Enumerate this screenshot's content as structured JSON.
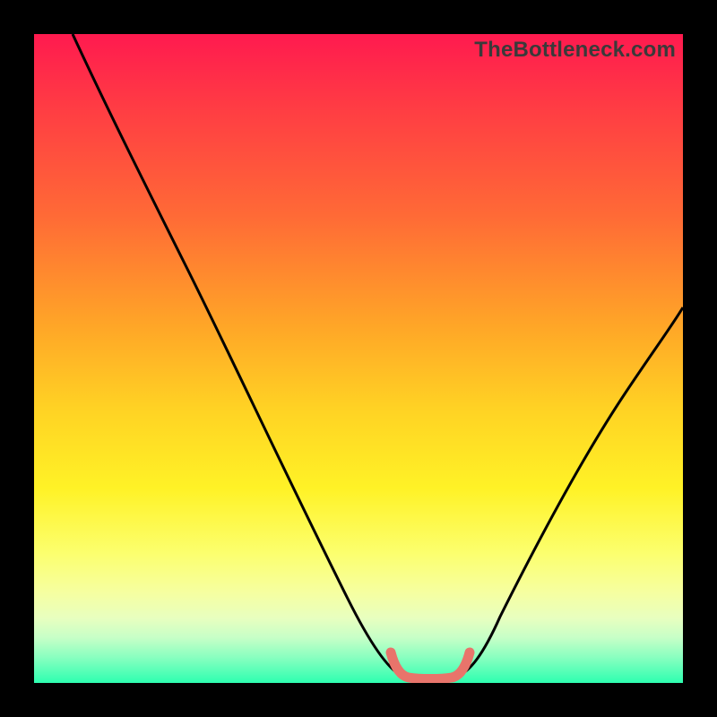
{
  "watermark": {
    "text": "TheBottleneck.com"
  },
  "chart_data": {
    "type": "line",
    "title": "",
    "xlabel": "",
    "ylabel": "",
    "xlim": [
      0,
      100
    ],
    "ylim": [
      0,
      100
    ],
    "series": [
      {
        "name": "curve-left",
        "x": [
          6,
          12,
          20,
          28,
          36,
          44,
          52,
          55,
          56.5
        ],
        "values": [
          100,
          90,
          77,
          63,
          48,
          32,
          14,
          5,
          2
        ]
      },
      {
        "name": "curve-right",
        "x": [
          65.5,
          67,
          70,
          76,
          82,
          88,
          94,
          100
        ],
        "values": [
          2,
          5,
          11,
          23,
          33,
          42,
          50,
          58
        ]
      },
      {
        "name": "valley-marker",
        "x": [
          55,
          56.5,
          58,
          61,
          64,
          65.5,
          67
        ],
        "values": [
          5,
          2,
          1,
          1,
          1,
          2,
          5
        ]
      }
    ],
    "annotations": [
      {
        "text": "TheBottleneck.com",
        "position": "top-right"
      }
    ]
  }
}
